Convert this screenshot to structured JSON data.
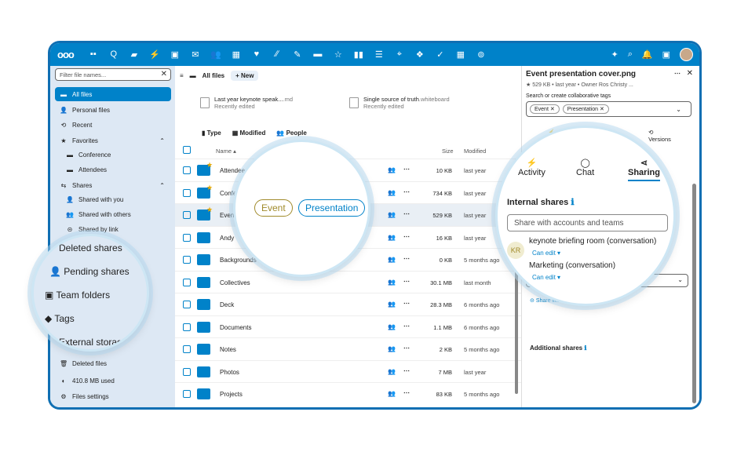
{
  "topbar": {
    "logo": "ooo",
    "app_icons": [
      "▪▪",
      "Q",
      "▰",
      "⚡",
      "▣",
      "✉",
      "👥",
      "▦",
      "♥",
      "∕∕",
      "✎",
      "▬",
      "☆",
      "▮▮",
      "☰",
      "⌖",
      "❖",
      "✓",
      "▦",
      "⊚"
    ],
    "right_icons": [
      "✦",
      "⌕",
      "🔔",
      "▣"
    ]
  },
  "sidebar": {
    "filter_placeholder": "Filter file names...",
    "items": [
      {
        "icon": "▬",
        "label": "All files"
      },
      {
        "icon": "👤",
        "label": "Personal files"
      },
      {
        "icon": "⟲",
        "label": "Recent"
      },
      {
        "icon": "★",
        "label": "Favorites"
      },
      {
        "icon": "▬",
        "label": "Conference"
      },
      {
        "icon": "▬",
        "label": "Attendees"
      },
      {
        "icon": "⇆",
        "label": "Shares"
      },
      {
        "icon": "👤",
        "label": "Shared with you"
      },
      {
        "icon": "👥",
        "label": "Shared with others"
      },
      {
        "icon": "⊝",
        "label": "Shared by link"
      },
      {
        "icon": "",
        "label": "Deleted shares"
      },
      {
        "icon": "",
        "label": "Pending shares"
      },
      {
        "icon": "",
        "label": "Team folders"
      },
      {
        "icon": "",
        "label": "Tags"
      },
      {
        "icon": "",
        "label": "External storage"
      },
      {
        "icon": "🗑",
        "label": "Deleted files"
      },
      {
        "icon": "◐",
        "label": "410.8 MB used"
      },
      {
        "icon": "⚙",
        "label": "Files settings"
      }
    ]
  },
  "main": {
    "breadcrumb": "All files",
    "new_label": "New",
    "recent": [
      {
        "name": "Last year keynote speak...",
        "ext": ".md",
        "sub": "Recently edited"
      },
      {
        "name": "Single source of truth",
        "ext": ".whiteboard",
        "sub": "Recently edited"
      }
    ],
    "filters": [
      "Type",
      "Modified",
      "People"
    ],
    "headers": {
      "name": "Name ▴",
      "size": "Size",
      "modified": "Modified"
    },
    "rows": [
      {
        "name": "Attendees",
        "size": "10 KB",
        "modified": "last year",
        "star": true
      },
      {
        "name": "Conference",
        "size": "734 KB",
        "modified": "last year",
        "star": true
      },
      {
        "name": "Event presentation cover",
        "size": "529 KB",
        "modified": "last year",
        "star": true
      },
      {
        "name": "Andy",
        "size": "16 KB",
        "modified": "last year",
        "star": false
      },
      {
        "name": "Backgrounds",
        "size": "0 KB",
        "modified": "5 months ago",
        "star": false
      },
      {
        "name": "Collectives",
        "size": "30.1 MB",
        "modified": "last month",
        "star": false
      },
      {
        "name": "Deck",
        "size": "28.3 MB",
        "modified": "6 months ago",
        "star": false
      },
      {
        "name": "Documents",
        "size": "1.1 MB",
        "modified": "6 months ago",
        "star": false
      },
      {
        "name": "Notes",
        "size": "2 KB",
        "modified": "5 months ago",
        "star": false
      },
      {
        "name": "Photos",
        "size": "7 MB",
        "modified": "last year",
        "star": false
      },
      {
        "name": "Projects",
        "size": "83 KB",
        "modified": "5 months ago",
        "star": false
      }
    ]
  },
  "panel": {
    "title": "Event presentation cover.png",
    "meta": "529 KB • last year • Owner  Ros Christy ...",
    "tags_label": "Search or create collaborative tags",
    "tags": [
      "Event",
      "Presentation"
    ],
    "tabs": [
      "Activity",
      "Chat",
      "Sharing",
      "Versions"
    ],
    "internal_shares": "Internal shares",
    "share_placeholder": "Share with accounts and teams",
    "shares": [
      {
        "initials": "KR",
        "name": "keynote briefing room (conversation)",
        "perm": "Can edit"
      },
      {
        "initials": "",
        "name": "Marketing (conversation)",
        "perm": "Can edit"
      }
    ],
    "share_link": "Share link",
    "additional_shares": "Additional shares"
  },
  "loupe_tags": {
    "event": "Event",
    "presentation": "Presentation"
  },
  "colors": {
    "primary": "#0082c9",
    "sidebar": "#dde8f4",
    "event_tag": "#a08a2a"
  }
}
